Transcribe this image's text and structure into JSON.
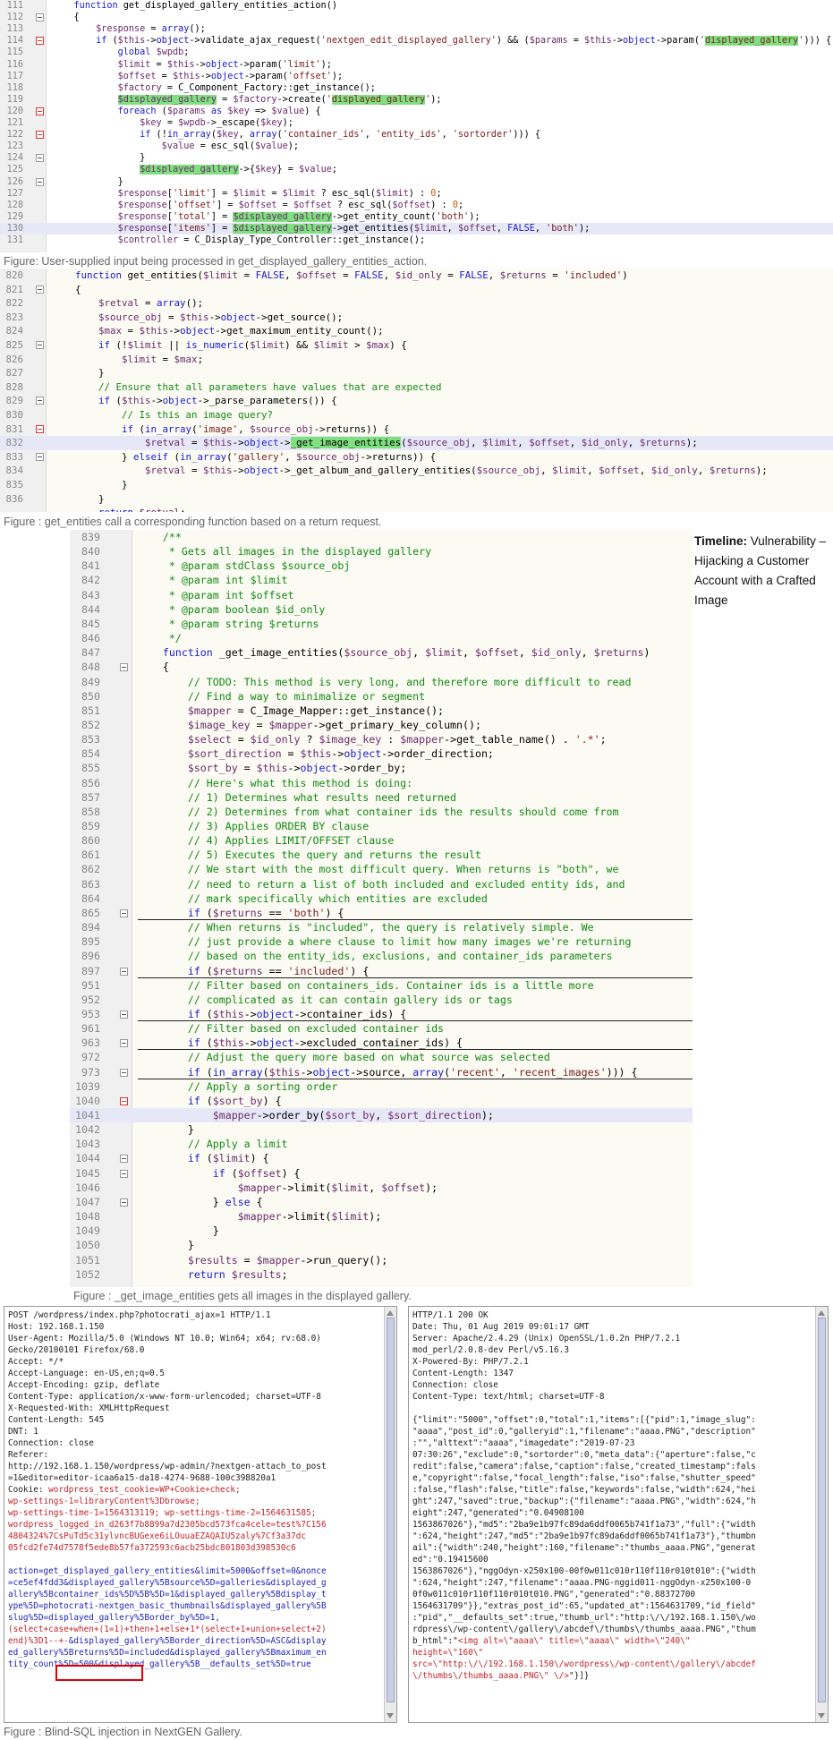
{
  "figures": {
    "fig1_caption": "Figure: User-supplied input being processed in get_displayed_gallery_entities_action.",
    "fig2_caption": "Figure : get_entities call a corresponding function based on a return request.",
    "fig3_caption": "Figure :  _get_image_entities gets all images in the displayed gallery.",
    "fig4_caption": "Figure : Blind-SQL injection in NextGEN Gallery."
  },
  "timeline": {
    "label": "Timeline:",
    "text": " Vulnerability – Hijacking a Customer Account with a Crafted Image"
  },
  "code1": {
    "line_numbers": [
      "111",
      "112",
      "113",
      "114",
      "115",
      "116",
      "117",
      "118",
      "119",
      "120",
      "121",
      "122",
      "123",
      "124",
      "125",
      "126",
      "127",
      "128",
      "129",
      "130",
      "131"
    ]
  },
  "code2": {
    "line_numbers": [
      "820",
      "821",
      "822",
      "823",
      "824",
      "825",
      "826",
      "827",
      "828",
      "829",
      "830",
      "831",
      "832",
      "833",
      "834",
      "835",
      "836"
    ]
  },
  "code3": {
    "line_numbers": [
      "839",
      "840",
      "841",
      "842",
      "843",
      "844",
      "845",
      "846",
      "847",
      "848",
      "849",
      "850",
      "851",
      "852",
      "853",
      "854",
      "855",
      "856",
      "857",
      "858",
      "859",
      "860",
      "861",
      "862",
      "863",
      "864",
      "865",
      "894",
      "895",
      "896",
      "897",
      "951",
      "952",
      "953",
      "961",
      "963",
      "972",
      "973",
      "1039",
      "1040",
      "1041",
      "1042",
      "1043",
      "1044",
      "1045",
      "1046",
      "1047",
      "1048",
      "1049",
      "1050",
      "1051",
      "1052"
    ]
  },
  "http_request": {
    "request_line": "POST /wordpress/index.php?photocrati_ajax=1 HTTP/1.1"
  },
  "http_response": {
    "status_line": "HTTP/1.1 200 OK"
  }
}
